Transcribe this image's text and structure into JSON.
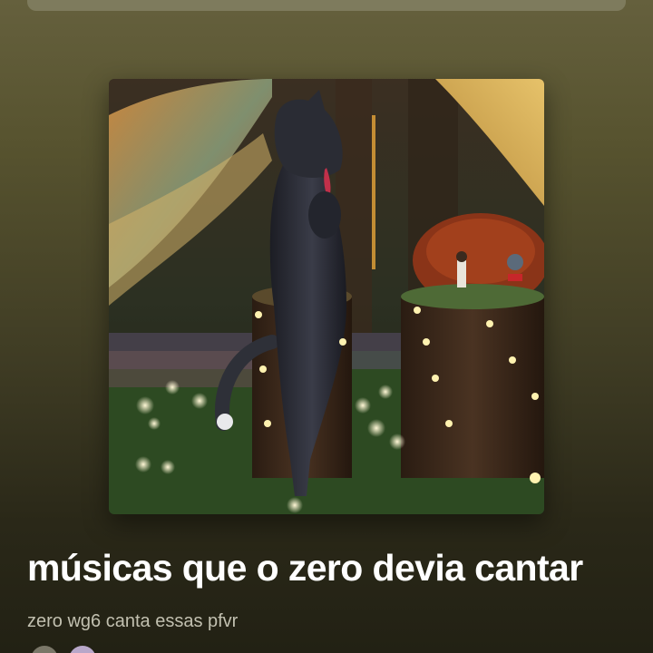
{
  "playlist": {
    "title": "músicas que o zero devia cantar",
    "description": "zero wg6 canta essas pfvr"
  },
  "cover": {
    "subject": "black cat standing on hind legs in a fairy-light forest stage"
  },
  "icons": {
    "avatar_1": "user-avatar",
    "avatar_2": "user-avatar"
  },
  "colors": {
    "background_top": "#65603d",
    "background_bottom": "#222114",
    "title": "#ffffff",
    "description": "#c2c0b0"
  }
}
